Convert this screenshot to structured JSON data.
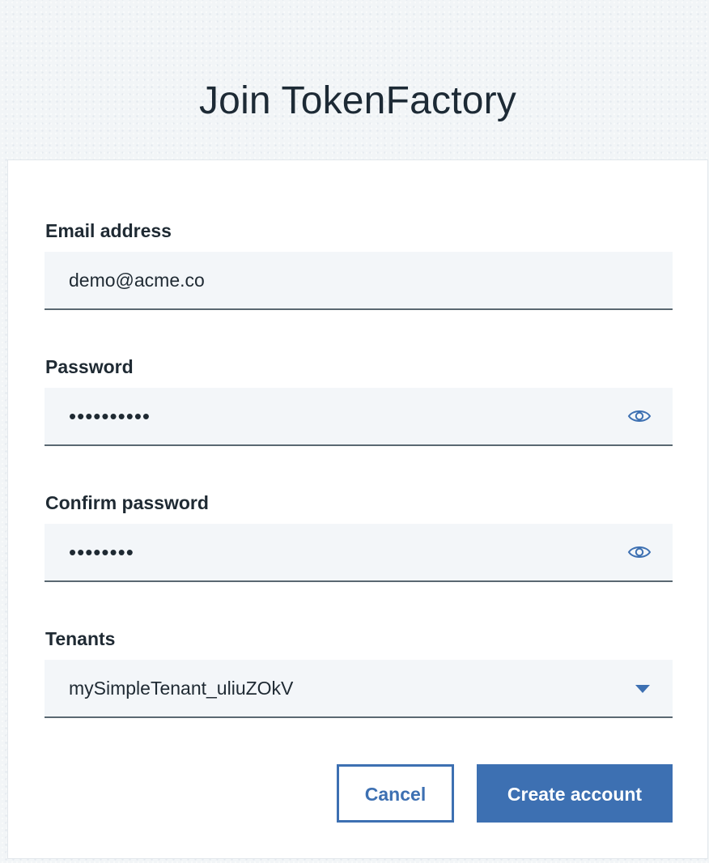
{
  "page": {
    "title": "Join TokenFactory"
  },
  "form": {
    "email": {
      "label": "Email address",
      "value": "demo@acme.co"
    },
    "password": {
      "label": "Password",
      "value": "••••••••••",
      "toggle_icon": "eye-icon"
    },
    "confirm_password": {
      "label": "Confirm password",
      "value": "••••••••",
      "toggle_icon": "eye-icon"
    },
    "tenants": {
      "label": "Tenants",
      "selected": "mySimpleTenant_uliuZOkV",
      "icon": "caret-down-icon"
    }
  },
  "actions": {
    "cancel_label": "Cancel",
    "create_label": "Create account"
  },
  "colors": {
    "accent": "#3d70b2",
    "field_background": "#f3f6f9",
    "field_border": "#5a6872",
    "page_background": "#f2f5f7",
    "text": "#1f2a33"
  }
}
